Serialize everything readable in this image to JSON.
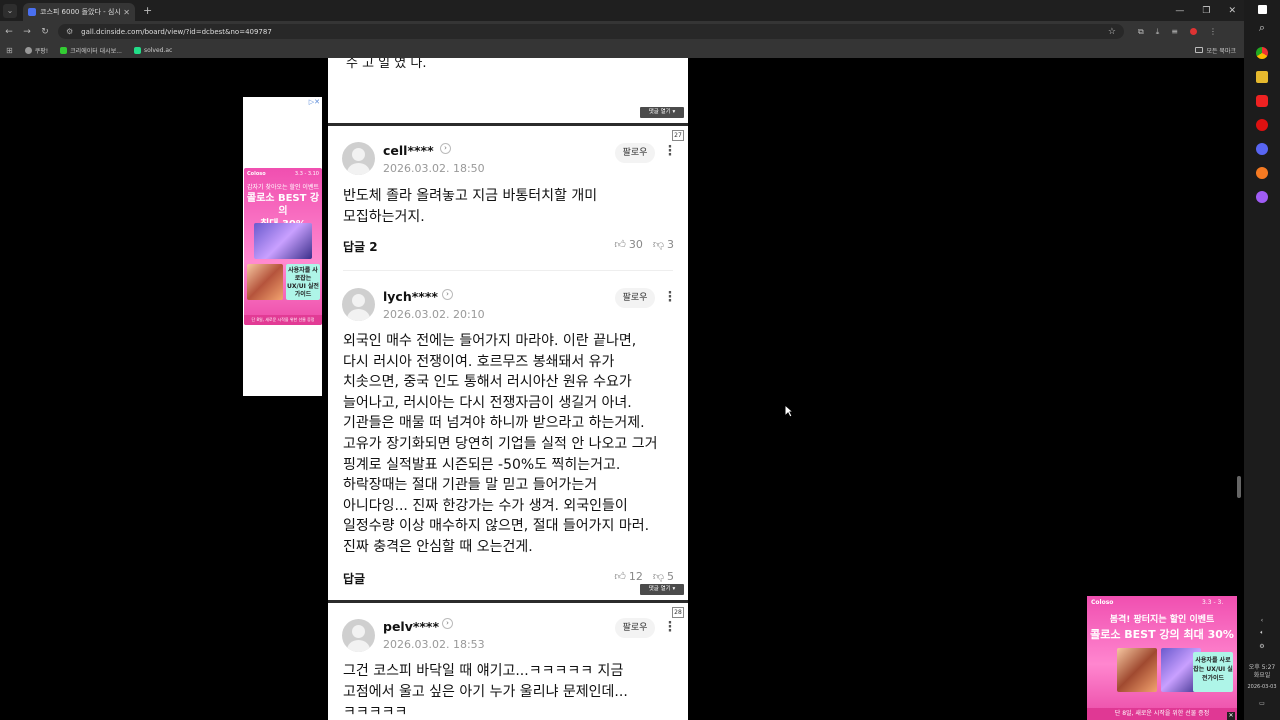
{
  "browser": {
    "tab_title": "코스피 6000 돌았다 - 심시간 ...",
    "url": "gall.dcinside.com/board/view/?id=dcbest&no=409787",
    "bookmarks": [
      "쿠팡!",
      "크리에이터 대시보...",
      "solved.ac"
    ],
    "bookmarks_right": "모든 북마크"
  },
  "taskbar": {
    "time": "오후 5:27",
    "weekday": "화요일",
    "date": "2026-03-03"
  },
  "ads": {
    "left": {
      "brand": "Coloso",
      "date": "3.3 - 3.10",
      "sub": "갑자기 찾아오는 할인 이벤트",
      "headline_1": "콜로소 BEST 강의",
      "headline_2": "최대 30%",
      "box": "사용자를 사로잡는 UX/UI 실전 가이드",
      "footer": "단 8일, 새로운 시작을 위한 선물 증정"
    },
    "bottom_right": {
      "brand": "Coloso",
      "date": "3.3 - 3.",
      "sub": "봄격! 팡터지는 할인 이벤트",
      "headline": "콜로소 BEST 강의 최대 30%",
      "box": "사용자를 사로잡는 UX/UI 실전가이드",
      "footer": "단 8일, 새로운 시작을 위한 선물 증정"
    }
  },
  "page": {
    "top_fragment": "수 고 일 였 다.",
    "reply_toggle": "댓글 열기 ▾",
    "comments": [
      {
        "number": "27",
        "username": "cell****",
        "date": "2026.03.02. 18:50",
        "follow": "팔로우",
        "text": "반도체 졸라 올려놓고 지금 바통터치할 개미 모집하는거지.",
        "reply": "답글 2",
        "up": "30",
        "down": "3"
      },
      {
        "number": "",
        "username": "lych****",
        "date": "2026.03.02. 20:10",
        "follow": "팔로우",
        "text": "외국인 매수 전에는 들어가지 마라야. 이란 끝나면, 다시 러시아 전쟁이여. 호르무즈 봉쇄돼서 유가 치솟으면, 중국 인도 통해서 러시아산 원유 수요가 늘어나고, 러시아는 다시 전쟁자금이 생길거 아녀. 기관들은 매물 떠 넘겨야 하니까 받으라고 하는거제. 고유가 장기화되면 당연히 기업들 실적 안 나오고 그거 핑계로 실적발표 시즌되믄 -50%도 찍히는거고. 하락장때는 절대 기관들 말 믿고 들어가는거 아니다잉... 진짜 한강가는 수가 생겨. 외국인들이 일정수량 이상 매수하지 않으면, 절대 들어가지 마러. 진짜 충격은 안심할 때 오는건게.",
        "reply": "답글",
        "up": "12",
        "down": "5"
      },
      {
        "number": "28",
        "username": "pelv****",
        "date": "2026.03.02. 18:53",
        "follow": "팔로우",
        "text": "그건 코스피 바닥일 때 얘기고...ㅋㅋㅋㅋㅋ 지금 고점에서 울고 싶은 아기 누가 울리냐 문제인데...ㅋㅋㅋㅋㅋ",
        "reply": "",
        "up": "",
        "down": ""
      }
    ]
  }
}
